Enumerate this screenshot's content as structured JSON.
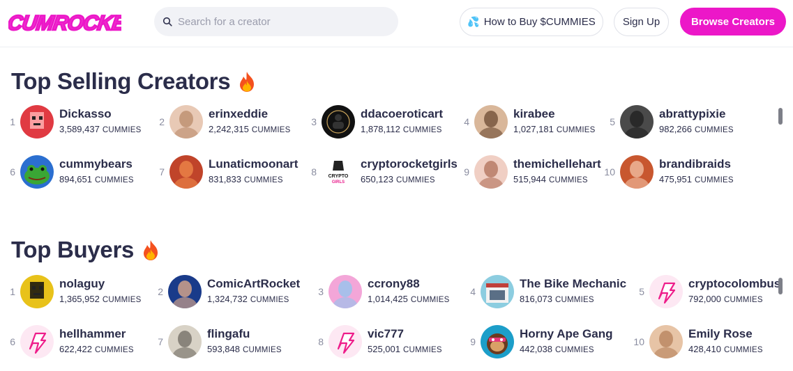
{
  "header": {
    "logo_text": "CUMROCKET",
    "search_placeholder": "Search for a creator",
    "how_to_buy": "How to Buy $CUMMIES",
    "sign_up": "Sign Up",
    "browse_creators": "Browse Creators"
  },
  "colors": {
    "accent": "#ec17c8",
    "text": "#2b2d4a",
    "muted": "#8a8da0"
  },
  "top_selling": {
    "title": "Top Selling Creators",
    "icon": "fire-icon",
    "items": [
      {
        "rank": "1",
        "name": "Dickasso",
        "amount": "3,589,437",
        "unit": "CUMMIES",
        "avatar": {
          "bg": "#e03a42",
          "fg": "#ffb0b0",
          "type": "pixel"
        }
      },
      {
        "rank": "2",
        "name": "erinxeddie",
        "amount": "2,242,315",
        "unit": "CUMMIES",
        "avatar": {
          "bg": "#e8c9b5",
          "fg": "#b98a6a",
          "type": "photo"
        }
      },
      {
        "rank": "3",
        "name": "ddacoeroticart",
        "amount": "1,878,112",
        "unit": "CUMMIES",
        "avatar": {
          "bg": "#111111",
          "fg": "#c9a35a",
          "type": "dark"
        }
      },
      {
        "rank": "4",
        "name": "kirabee",
        "amount": "1,027,181",
        "unit": "CUMMIES",
        "avatar": {
          "bg": "#d9b79a",
          "fg": "#6b4a32",
          "type": "photo"
        }
      },
      {
        "rank": "5",
        "name": "abrattypixie",
        "amount": "982,266",
        "unit": "CUMMIES",
        "avatar": {
          "bg": "#4a4a4a",
          "fg": "#1f1f1f",
          "type": "photo"
        }
      },
      {
        "rank": "6",
        "name": "cummybears",
        "amount": "894,651",
        "unit": "CUMMIES",
        "avatar": {
          "bg": "#2b6fd0",
          "fg": "#3aa635",
          "type": "frog"
        }
      },
      {
        "rank": "7",
        "name": "Lunaticmoonart",
        "amount": "831,833",
        "unit": "CUMMIES",
        "avatar": {
          "bg": "#c0442a",
          "fg": "#f08a4b",
          "type": "photo"
        }
      },
      {
        "rank": "8",
        "name": "cryptorocketgirls",
        "amount": "650,123",
        "unit": "CUMMIES",
        "avatar": {
          "bg": "#ffffff",
          "fg": "#222222",
          "type": "logo"
        }
      },
      {
        "rank": "9",
        "name": "themichellehart",
        "amount": "515,944",
        "unit": "CUMMIES",
        "avatar": {
          "bg": "#f0cfc4",
          "fg": "#b0705a",
          "type": "photo"
        }
      },
      {
        "rank": "10",
        "name": "brandibraids",
        "amount": "475,951",
        "unit": "CUMMIES",
        "avatar": {
          "bg": "#c8572f",
          "fg": "#f3c3a8",
          "type": "photo"
        }
      }
    ]
  },
  "top_buyers": {
    "title": "Top Buyers",
    "icon": "fire-icon",
    "items": [
      {
        "rank": "1",
        "name": "nolaguy",
        "amount": "1,365,952",
        "unit": "CUMMIES",
        "avatar": {
          "bg": "#e8c21a",
          "fg": "#111111",
          "type": "pixel"
        }
      },
      {
        "rank": "2",
        "name": "ComicArtRocket",
        "amount": "1,324,732",
        "unit": "CUMMIES",
        "avatar": {
          "bg": "#1a3b8a",
          "fg": "#e9b08a",
          "type": "photo"
        }
      },
      {
        "rank": "3",
        "name": "ccrony88",
        "amount": "1,014,425",
        "unit": "CUMMIES",
        "avatar": {
          "bg": "#f3a6d8",
          "fg": "#8fc7f0",
          "type": "photo"
        }
      },
      {
        "rank": "4",
        "name": "The Bike Mechanic",
        "amount": "816,073",
        "unit": "CUMMIES",
        "avatar": {
          "bg": "#8ccde0",
          "fg": "#c0403a",
          "type": "shop"
        }
      },
      {
        "rank": "5",
        "name": "cryptocolombus",
        "amount": "792,000",
        "unit": "CUMMIES",
        "avatar": {
          "bg": "#fde8f3",
          "fg": "#ee1d8a",
          "type": "brand"
        }
      },
      {
        "rank": "6",
        "name": "hellhammer",
        "amount": "622,422",
        "unit": "CUMMIES",
        "avatar": {
          "bg": "#fde8f3",
          "fg": "#ee1d8a",
          "type": "brand"
        }
      },
      {
        "rank": "7",
        "name": "flingafu",
        "amount": "593,848",
        "unit": "CUMMIES",
        "avatar": {
          "bg": "#d8d2c6",
          "fg": "#6f6a62",
          "type": "photo"
        }
      },
      {
        "rank": "8",
        "name": "vic777",
        "amount": "525,001",
        "unit": "CUMMIES",
        "avatar": {
          "bg": "#fde8f3",
          "fg": "#ee1d8a",
          "type": "brand"
        }
      },
      {
        "rank": "9",
        "name": "Horny Ape Gang",
        "amount": "442,038",
        "unit": "CUMMIES",
        "avatar": {
          "bg": "#1c9ec9",
          "fg": "#e5397a",
          "type": "ape"
        }
      },
      {
        "rank": "10",
        "name": "Emily Rose",
        "amount": "428,410",
        "unit": "CUMMIES",
        "avatar": {
          "bg": "#e7c4a6",
          "fg": "#b5805a",
          "type": "photo"
        }
      }
    ]
  }
}
